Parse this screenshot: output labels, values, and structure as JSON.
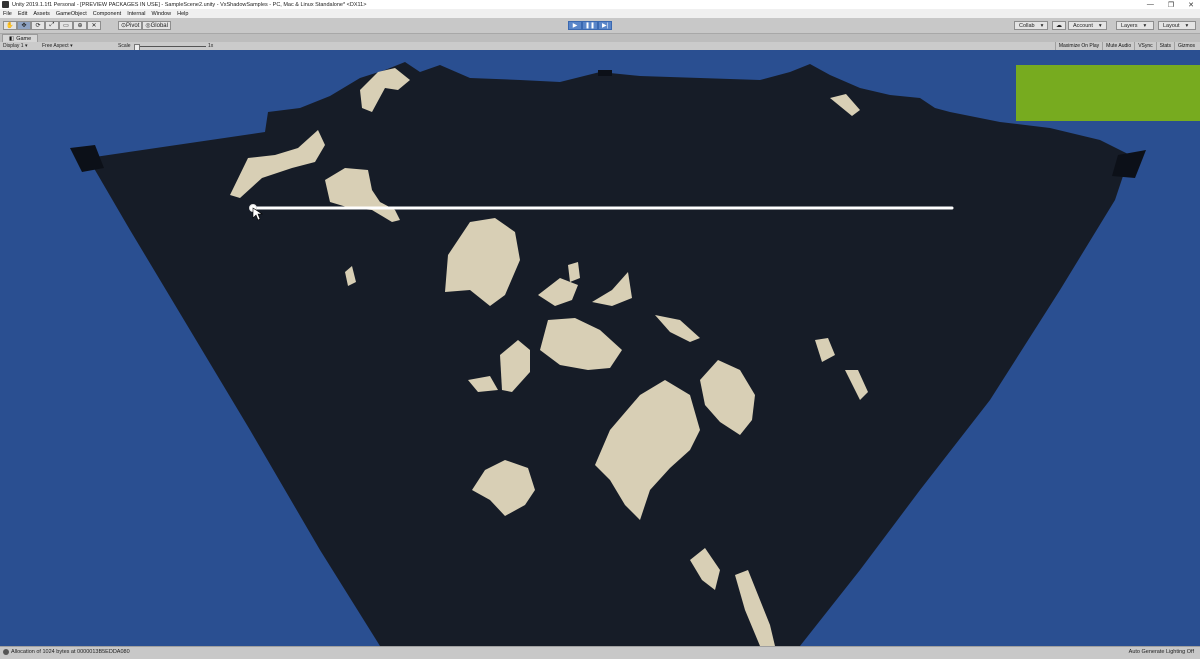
{
  "window": {
    "title": "Unity 2019.1.1f1 Personal - [PREVIEW PACKAGES IN USE] - SampleScene2.unity - VxShadowSamples - PC, Mac & Linux Standalone* <DX11>",
    "minimize": "—",
    "restore": "❐",
    "close": "✕"
  },
  "menu": [
    "File",
    "Edit",
    "Assets",
    "GameObject",
    "Component",
    "Internal",
    "Window",
    "Help"
  ],
  "toolbar": {
    "pivot_label": "Pivot",
    "global_label": "Global",
    "collab_label": "Collab",
    "account_label": "Account",
    "layers_label": "Layers",
    "layout_label": "Layout"
  },
  "game_tab": {
    "label": "Game"
  },
  "game_bar": {
    "display": "Display 1",
    "aspect": "Free Aspect",
    "scale_label": "Scale",
    "scale_value": "1x",
    "maximize_on_play": "Maximize On Play",
    "mute_audio": "Mute Audio",
    "vsync": "VSync",
    "stats": "Stats",
    "gizmos": "Gizmos"
  },
  "status": {
    "message": "Allocation of 1024 bytes at 0000013B5EDDA080",
    "right": "Auto Generate Lighting Off"
  },
  "colors": {
    "sky": "#2a4f91",
    "terrain": "#161c27",
    "highlight_green": "#77ab1f",
    "rock": "#d8cfb5"
  }
}
